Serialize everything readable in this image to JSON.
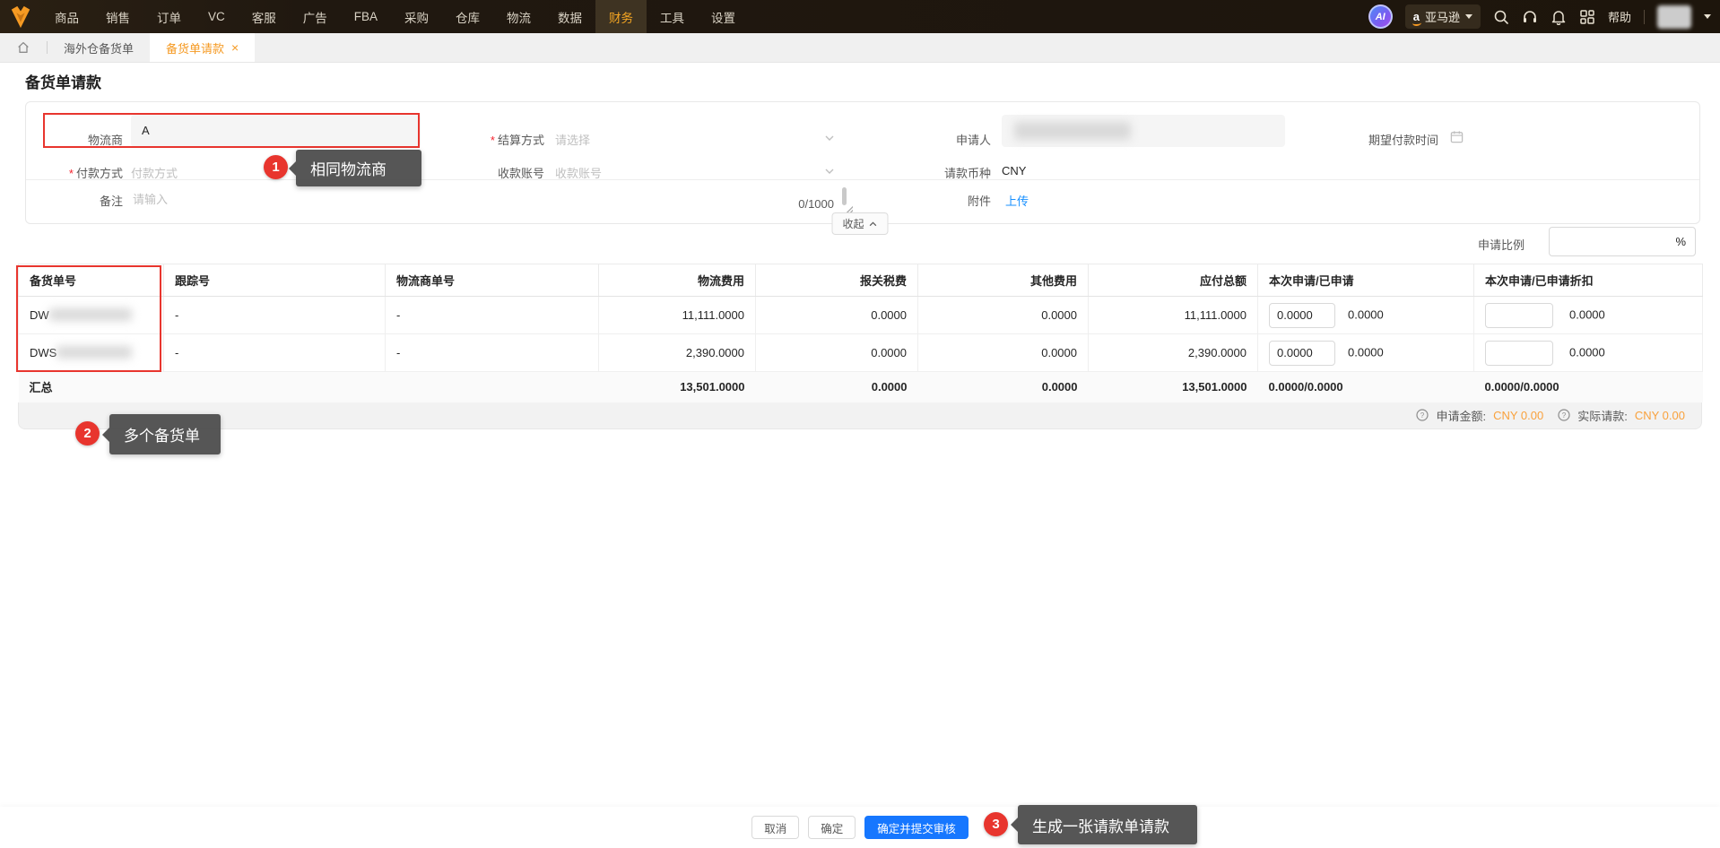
{
  "navbar": {
    "menu": [
      "商品",
      "销售",
      "订单",
      "VC",
      "客服",
      "广告",
      "FBA",
      "采购",
      "仓库",
      "物流",
      "数据",
      "财务",
      "工具",
      "设置"
    ],
    "active_item": "财务",
    "ai_badge": "AI",
    "store_selector": "亚马逊",
    "help_label": "帮助"
  },
  "tabs": {
    "breadcrumb_tab": "海外仓备货单",
    "active_tab": "备货单请款",
    "close_glyph": "×"
  },
  "page": {
    "title": "备货单请款"
  },
  "form": {
    "logistics_label": "物流商",
    "logistics_value": "A",
    "settlement_label": "结算方式",
    "settlement_placeholder": "请选择",
    "applicant_label": "申请人",
    "expected_date_label": "期望付款时间",
    "payment_method_label": "付款方式",
    "payment_method_placeholder": "付款方式",
    "receiving_account_label": "收款账号",
    "receiving_account_placeholder": "收款账号",
    "currency_label": "请款币种",
    "currency_value": "CNY",
    "remark_label": "备注",
    "remark_placeholder": "请输入",
    "remark_counter": "0/1000",
    "attachment_label": "附件",
    "upload_link": "上传",
    "collapse_label": "收起",
    "ratio_label": "申请比例",
    "ratio_suffix": "%"
  },
  "annotations": {
    "a1": {
      "num": "1",
      "text": "相同物流商"
    },
    "a2": {
      "num": "2",
      "text": "多个备货单"
    },
    "a3": {
      "num": "3",
      "text": "生成一张请款单请款"
    }
  },
  "table": {
    "headers": [
      "备货单号",
      "跟踪号",
      "物流商单号",
      "物流费用",
      "报关税费",
      "其他费用",
      "应付总额",
      "本次申请/已申请",
      "本次申请/已申请折扣"
    ],
    "rows": [
      {
        "order_prefix": "DW",
        "tracking": "-",
        "carrier_no": "-",
        "logistics_fee": "11,111.0000",
        "customs_fee": "0.0000",
        "other_fee": "0.0000",
        "total_payable": "11,111.0000",
        "apply_input": "0.0000",
        "applied": "0.0000",
        "discount_applied": "0.0000"
      },
      {
        "order_prefix": "DWS",
        "tracking": "-",
        "carrier_no": "-",
        "logistics_fee": "2,390.0000",
        "customs_fee": "0.0000",
        "other_fee": "0.0000",
        "total_payable": "2,390.0000",
        "apply_input": "0.0000",
        "applied": "0.0000",
        "discount_applied": "0.0000"
      }
    ],
    "summary": {
      "label": "汇总",
      "logistics_fee": "13,501.0000",
      "customs_fee": "0.0000",
      "other_fee": "0.0000",
      "total_payable": "13,501.0000",
      "apply": "0.0000/0.0000",
      "discount": "0.0000/0.0000"
    },
    "footer": {
      "apply_amount_label": "申请金额:",
      "apply_amount_value": "CNY 0.00",
      "actual_label": "实际请款:",
      "actual_value": "CNY 0.00"
    }
  },
  "actions": {
    "cancel": "取消",
    "confirm": "确定",
    "confirm_submit": "确定并提交审核"
  },
  "colors": {
    "accent_orange": "#f5a623",
    "primary_blue": "#1677ff",
    "annotation_red": "#e8352e",
    "link_blue": "#1890ff",
    "money_orange": "#f9a13c"
  }
}
